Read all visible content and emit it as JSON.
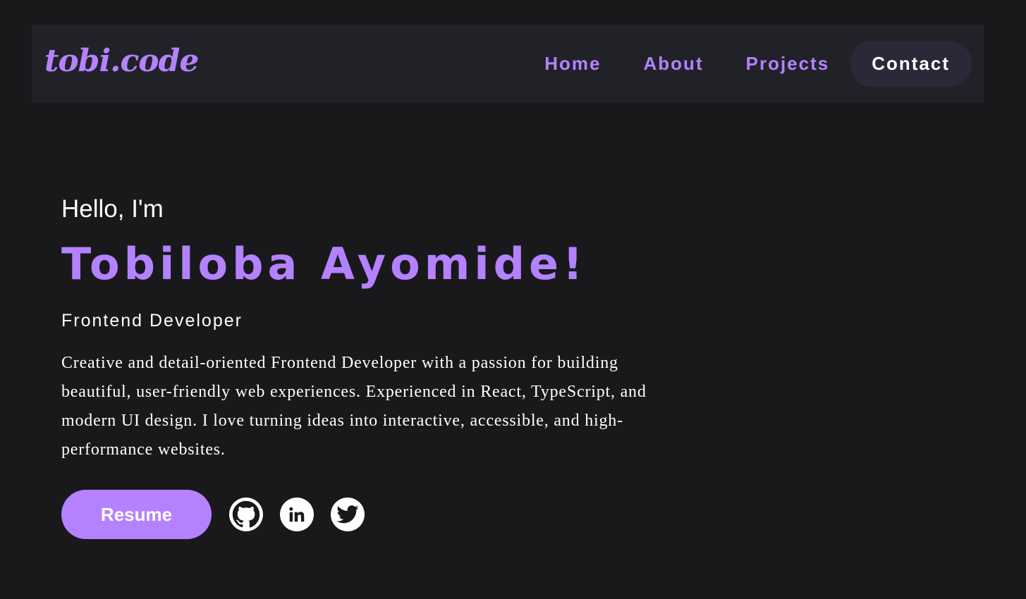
{
  "header": {
    "logo": "tobi.code",
    "nav": [
      {
        "label": "Home"
      },
      {
        "label": "About"
      },
      {
        "label": "Projects"
      },
      {
        "label": "Contact",
        "active": true
      }
    ]
  },
  "hero": {
    "greeting": "Hello, I'm",
    "name": "Tobiloba Ayomide!",
    "role": "Frontend Developer",
    "bio": "Creative and detail-oriented Frontend Developer with a passion for building beautiful, user-friendly web experiences. Experienced in React, TypeScript, and modern UI design. I love turning ideas into interactive, accessible, and high-performance websites.",
    "resume_label": "Resume",
    "socials": [
      {
        "icon": "github-icon"
      },
      {
        "icon": "linkedin-icon"
      },
      {
        "icon": "twitter-icon"
      }
    ]
  },
  "colors": {
    "background": "#19191c",
    "navbar": "#212228",
    "accent": "#b482ff",
    "active_nav_bg": "#2d2838",
    "text": "#ffffff"
  }
}
